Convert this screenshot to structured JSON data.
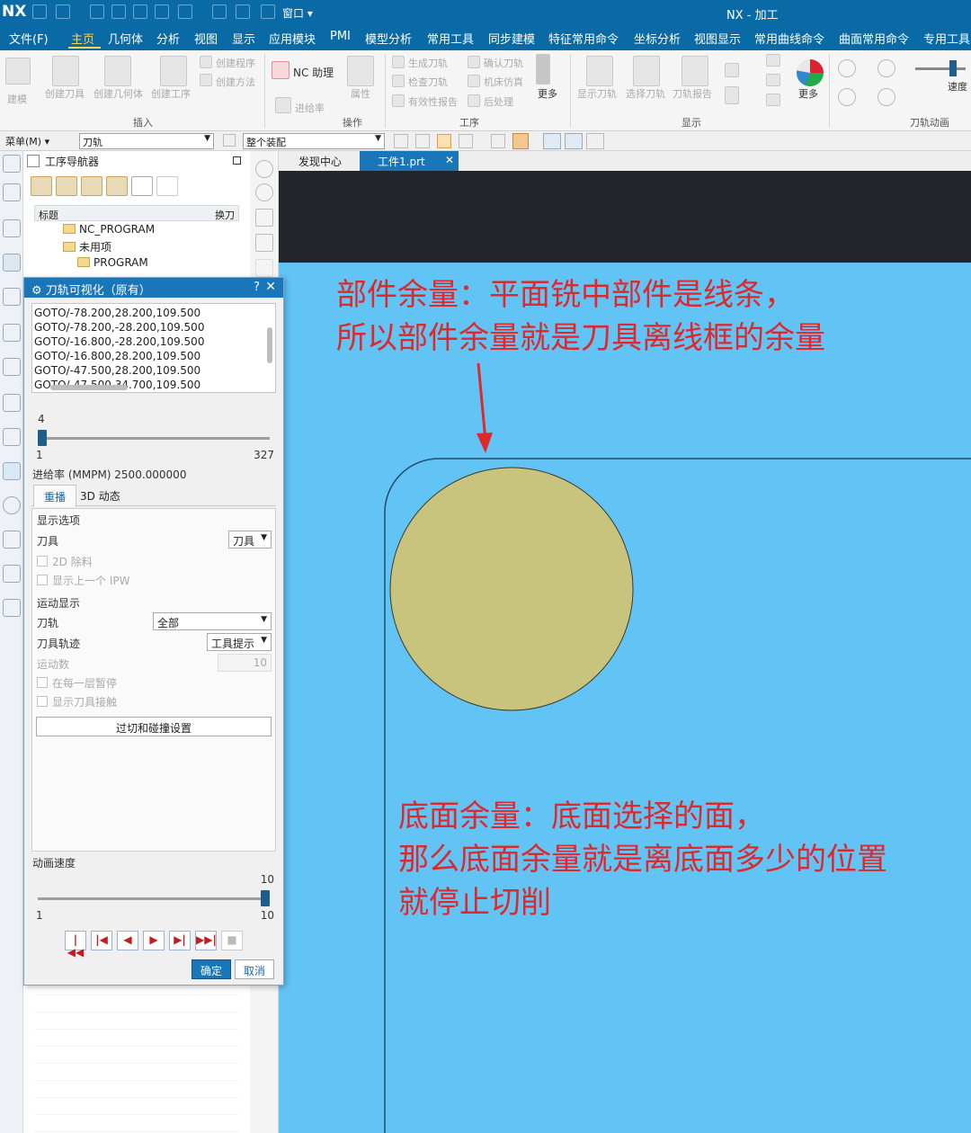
{
  "titlebar": {
    "logo": "NX",
    "window_menu": "窗口 ▾",
    "title": "NX - 加工"
  },
  "menubar": {
    "items": [
      "文件(F)",
      "主页",
      "几何体",
      "分析",
      "视图",
      "显示",
      "应用模块",
      "PMI",
      "模型分析",
      "常用工具",
      "同步建模",
      "特征常用命令",
      "坐标分析",
      "视图显示",
      "常用曲线命令",
      "曲面常用命令",
      "专用工具"
    ],
    "active": "主页"
  },
  "ribbon": {
    "insert": {
      "b1": "建模",
      "b2": "创建刀具",
      "b3": "创建几何体",
      "b4": "创建工序",
      "b5": "创建程序",
      "b6": "创建方法",
      "group": "插入"
    },
    "nc": {
      "assistant": "NC 助理",
      "feed": "进给率"
    },
    "ops": {
      "prop": "属性",
      "group": "操作"
    },
    "process": {
      "gen": "生成刀轨",
      "confirm": "确认刀轨",
      "check": "检查刀轨",
      "sim": "机床仿真",
      "valid": "有效性报告",
      "post": "后处理",
      "more": "更多",
      "group": "工序"
    },
    "display": {
      "show": "显示刀轨",
      "select": "选择刀轨",
      "report": "刀轨报告",
      "more": "更多",
      "group": "显示"
    },
    "anim": {
      "speed": "速度",
      "group": "刀轨动画"
    }
  },
  "toolbar": {
    "menu": "菜单(M) ▾",
    "filter": "刀轨",
    "assembly": "整个装配"
  },
  "navigator": {
    "title": "工序导航器",
    "col_title": "标题",
    "col_switch": "换刀",
    "n1": "NC_PROGRAM",
    "n2": "未用项",
    "n3": "PROGRAM"
  },
  "tabs": {
    "discover": "发现中心",
    "file": "工件1.prt"
  },
  "dialog": {
    "title": "刀轨可视化（原有）",
    "help": "?",
    "close": "✕",
    "goto_lines": [
      "GOTO/-78.200,28.200,109.500",
      "GOTO/-78.200,-28.200,109.500",
      "GOTO/-16.800,-28.200,109.500",
      "GOTO/-16.800,28.200,109.500",
      "GOTO/-47.500,28.200,109.500",
      "GOTO/-47.500,34.700,109.500"
    ],
    "slider_current": "4",
    "slider_current_value": 4,
    "slider_min": "1",
    "slider_max": "327",
    "feed_rate": "进给率 (MMPM) 2500.000000",
    "tab_replay": "重播",
    "tab_3d": "3D 动态",
    "display_options": "显示选项",
    "tool_label": "刀具",
    "tool_value": "刀具",
    "remove_2d": "2D 除料",
    "show_prev_ipw": "显示上一个 IPW",
    "motion_display": "运动显示",
    "path_label": "刀轨",
    "path_value": "全部",
    "trace_label": "刀具轨迹",
    "trace_value": "工具提示",
    "motion_count_label": "运动数",
    "motion_count_value": "10",
    "pause_layer": "在每一层暂停",
    "show_contact": "显示刀具接触",
    "collision_btn": "过切和碰撞设置",
    "anim_speed": "动画速度",
    "speed_top": "10",
    "speed_min": "1",
    "speed_max": "10",
    "speed_value": 10,
    "ok": "确定",
    "cancel": "取消"
  },
  "annotations": {
    "part_line1": "部件余量：平面铣中部件是线条，",
    "part_line2": "所以部件余量就是刀具离线框的余量",
    "floor_line1": "底面余量：底面选择的面，",
    "floor_line2": "那么底面余量就是离底面多少的位置",
    "floor_line3": "就停止切削"
  },
  "colors": {
    "accent": "#0a6aa5",
    "viewport_bg": "#62c3f5",
    "annotation": "#e0282a",
    "tool_fill": "#c8c47e",
    "menu_active": "#ffd34a"
  }
}
